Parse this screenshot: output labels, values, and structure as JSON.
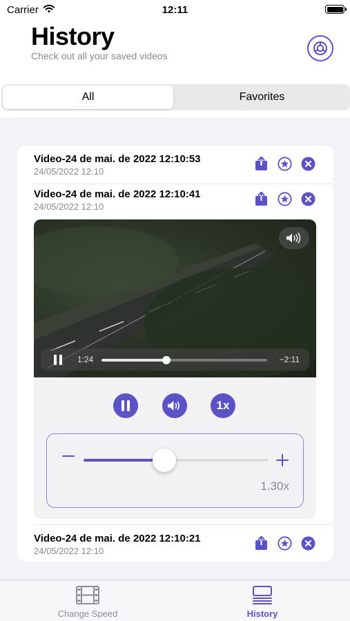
{
  "status_bar": {
    "carrier": "Carrier",
    "time": "12:11"
  },
  "header": {
    "title": "History",
    "subtitle": "Check out all your saved videos",
    "settings_icon": "settings-gear-icon"
  },
  "segments": {
    "all": "All",
    "favorites": "Favorites",
    "selected": "All"
  },
  "videos": [
    {
      "title": "Video-24 de mai. de 2022 12:10:53",
      "date": "24/05/2022 12:10"
    },
    {
      "title": "Video-24 de mai. de 2022 12:10:41",
      "date": "24/05/2022 12:10",
      "expanded": true
    },
    {
      "title": "Video-24 de mai. de 2022 12:10:21",
      "date": "24/05/2022 12:10"
    }
  ],
  "player": {
    "elapsed": "1:24",
    "remaining": "−2:11",
    "progress": 0.39,
    "speed_button": "1x",
    "speed_value": "1.30x",
    "speed_fraction": 0.44
  },
  "tabs": {
    "change_speed": "Change Speed",
    "history": "History",
    "selected": "History"
  },
  "colors": {
    "accent": "#5b52c7"
  }
}
